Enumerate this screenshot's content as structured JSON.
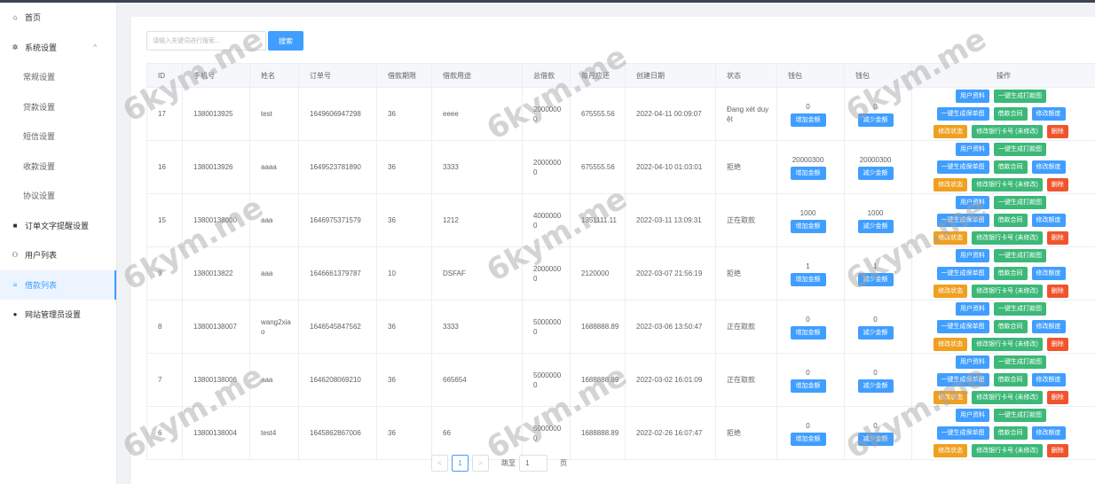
{
  "sidebar": {
    "items": [
      {
        "label": "首页",
        "icon": "home-icon",
        "glyph": "⌂",
        "type": "top"
      },
      {
        "label": "系统设置",
        "icon": "gear-icon",
        "glyph": "✲",
        "type": "group",
        "arrow": "^"
      },
      {
        "label": "常规设置",
        "type": "sub"
      },
      {
        "label": "贷款设置",
        "type": "sub"
      },
      {
        "label": "短信设置",
        "type": "sub"
      },
      {
        "label": "收款设置",
        "type": "sub"
      },
      {
        "label": "协议设置",
        "type": "sub"
      },
      {
        "label": "订单文字提醒设置",
        "icon": "order-icon",
        "glyph": "■",
        "type": "top"
      },
      {
        "label": "用户列表",
        "icon": "users-icon",
        "glyph": "⚇",
        "type": "top"
      },
      {
        "label": "借款列表",
        "icon": "list-icon",
        "glyph": "≡",
        "type": "top",
        "active": true
      },
      {
        "label": "网站管理员设置",
        "icon": "admin-icon",
        "glyph": "●",
        "type": "top"
      }
    ]
  },
  "search": {
    "placeholder": "请输入关键词进行搜索...",
    "button": "搜索"
  },
  "table": {
    "headers": [
      "ID",
      "手机号",
      "姓名",
      "订单号",
      "借款期限",
      "借款用途",
      "总借款",
      "每月应还",
      "创建日期",
      "状态",
      "钱包",
      "钱包",
      "操作"
    ],
    "rows": [
      {
        "id": "17",
        "phone": "1380013925",
        "name": "test",
        "order": "1649606947298",
        "term": "36",
        "purpose": "eeee",
        "total": "20000000",
        "monthly": "675555.56",
        "date": "2022-04-11 00:09:07",
        "status": "Đang xét duyệt",
        "wallet1": "0",
        "wallet2": "0"
      },
      {
        "id": "16",
        "phone": "1380013926",
        "name": "aaaa",
        "order": "1649523781890",
        "term": "36",
        "purpose": "3333",
        "total": "20000000",
        "monthly": "675555.56",
        "date": "2022-04-10 01:03:01",
        "status": "拒绝",
        "wallet1": "20000300",
        "wallet2": "20000300"
      },
      {
        "id": "15",
        "phone": "13800138000",
        "name": "aaa",
        "order": "1646975371579",
        "term": "36",
        "purpose": "1212",
        "total": "40000000",
        "monthly": "1351111.11",
        "date": "2022-03-11 13:09:31",
        "status": "正在取款",
        "wallet1": "1000",
        "wallet2": "1000"
      },
      {
        "id": "9",
        "phone": "1380013822",
        "name": "aaa",
        "order": "1646661379787",
        "term": "10",
        "purpose": "DSFAF",
        "total": "20000000",
        "monthly": "2120000",
        "date": "2022-03-07 21:56:19",
        "status": "拒绝",
        "wallet1": "1",
        "wallet2": "1"
      },
      {
        "id": "8",
        "phone": "13800138007",
        "name": "wang2xiao",
        "order": "1646545847562",
        "term": "36",
        "purpose": "3333",
        "total": "50000000",
        "monthly": "1688888.89",
        "date": "2022-03-06 13:50:47",
        "status": "正在取款",
        "wallet1": "0",
        "wallet2": "0"
      },
      {
        "id": "7",
        "phone": "13800138006",
        "name": "aaa",
        "order": "1646208069210",
        "term": "36",
        "purpose": "665654",
        "total": "50000000",
        "monthly": "1688888.89",
        "date": "2022-03-02 16:01:09",
        "status": "正在取款",
        "wallet1": "0",
        "wallet2": "0"
      },
      {
        "id": "6",
        "phone": "13800138004",
        "name": "test4",
        "order": "1645862867006",
        "term": "36",
        "purpose": "66",
        "total": "50000000",
        "monthly": "1688888.89",
        "date": "2022-02-26 16:07:47",
        "status": "拒绝",
        "wallet1": "0",
        "wallet2": "0"
      }
    ],
    "actions": {
      "user_info": "用户资料",
      "print_one_click": "一键生成打款图",
      "guarantee_one_click": "一键生成保单图",
      "contract": "借款合同",
      "edit_quota": "修改额度",
      "edit_status": "修改状态",
      "edit_bank": "修改银行卡号 (未修改)",
      "delete": "删除",
      "add_amount": "增加金额",
      "reduce_amount": "减少金额"
    }
  },
  "pagination": {
    "prev": "<",
    "current": "1",
    "next": ">",
    "jump_label": "跳至",
    "jump_value": "1",
    "page_label": "页"
  },
  "watermark": "6kym.me",
  "colors": {
    "primary": "#409eff",
    "success": "#3cb878",
    "warning": "#f0a020",
    "danger": "#f0542c"
  }
}
